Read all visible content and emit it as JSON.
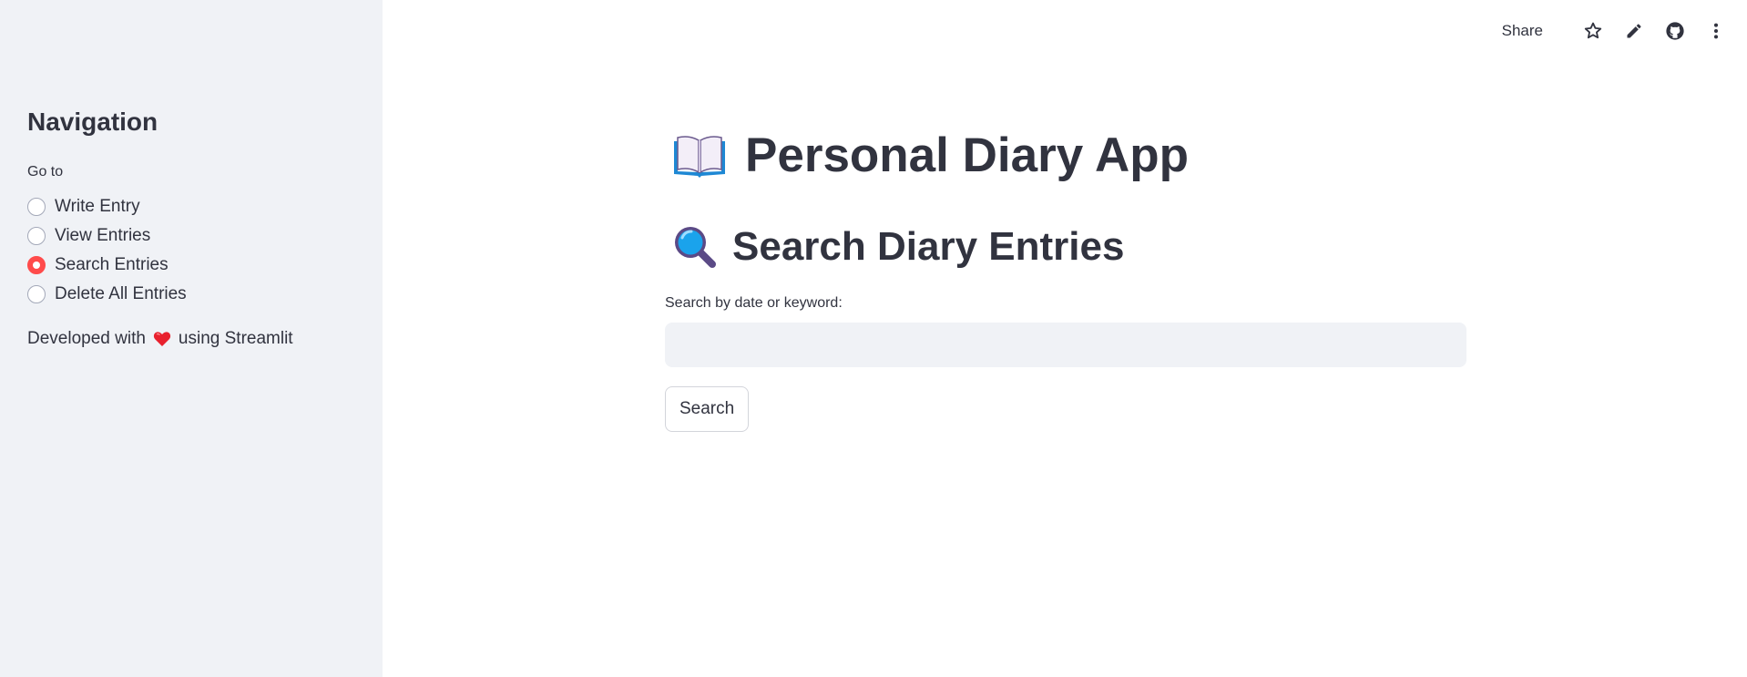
{
  "sidebar": {
    "title": "Navigation",
    "goto_label": "Go to",
    "options": [
      {
        "label": "Write Entry",
        "selected": false
      },
      {
        "label": "View Entries",
        "selected": false
      },
      {
        "label": "Search Entries",
        "selected": true
      },
      {
        "label": "Delete All Entries",
        "selected": false
      }
    ],
    "footer_prefix": "Developed with",
    "footer_icon": "heart-icon",
    "footer_suffix": "using Streamlit"
  },
  "toolbar": {
    "share_label": "Share",
    "icons": [
      "star-icon",
      "pencil-icon",
      "github-icon",
      "more-vertical-icon"
    ]
  },
  "main": {
    "title": "Personal Diary App",
    "title_icon": "open-book-icon",
    "subtitle": "Search Diary Entries",
    "subtitle_icon": "magnifying-glass-icon",
    "search_label": "Search by date or keyword:",
    "search_value": "",
    "search_placeholder": "",
    "search_button_label": "Search"
  },
  "colors": {
    "accent": "#ff4b4b",
    "sidebar_bg": "#f0f2f6",
    "text": "#31333f",
    "input_bg": "#f0f2f6"
  }
}
